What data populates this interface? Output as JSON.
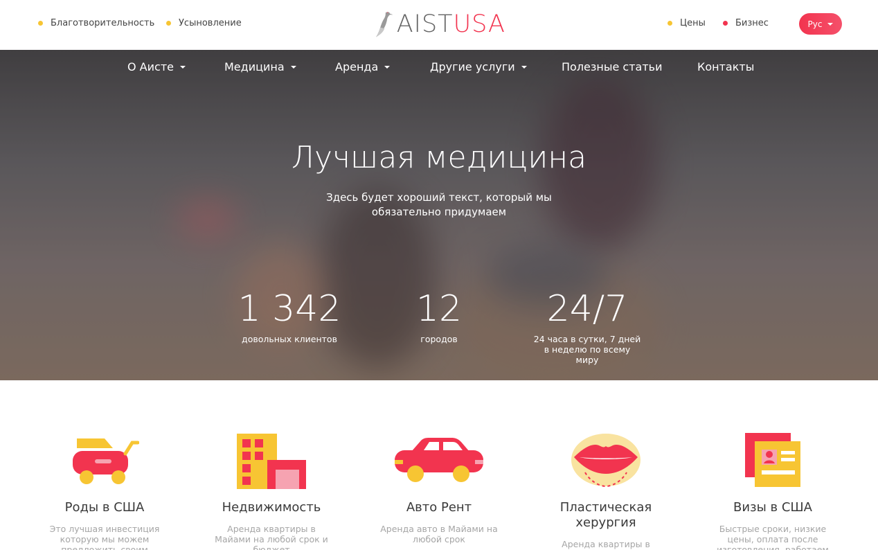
{
  "header": {
    "left_links": [
      "Благотворительность",
      "Усыновление"
    ],
    "logo": {
      "part1": "AIST",
      "part2": "USA"
    },
    "right_links": [
      "Цены",
      "Бизнес"
    ],
    "language": "Рус"
  },
  "nav": {
    "items": [
      {
        "label": "О Аисте",
        "dropdown": true
      },
      {
        "label": "Медицина",
        "dropdown": true
      },
      {
        "label": "Аренда",
        "dropdown": true
      },
      {
        "label": "Другие услуги",
        "dropdown": true
      },
      {
        "label": "Полезные статьи",
        "dropdown": false
      },
      {
        "label": "Контакты",
        "dropdown": false
      }
    ]
  },
  "hero": {
    "title": "Лучшая медицина",
    "subtitle": "Здесь будет хороший текст, который мы обязательно придумаем",
    "stats": [
      {
        "value": "1 342",
        "label": "довольных клиентов"
      },
      {
        "value": "12",
        "label": "городов"
      },
      {
        "value": "24/7",
        "label": "24 часа в сутки, 7 дней в неделю по всему миру"
      }
    ]
  },
  "services": [
    {
      "icon": "stroller-icon",
      "title": "Роды в США",
      "desc": "Это лучшая инвестиция которую мы можем предложить своим клиентам"
    },
    {
      "icon": "building-icon",
      "title": "Недвижимость",
      "desc": "Аренда квартиры в Майами на любой срок и бюджет"
    },
    {
      "icon": "car-icon",
      "title": "Авто Рент",
      "desc": "Аренда авто в Майами на любой срок"
    },
    {
      "icon": "lips-icon",
      "title": "Пластическая херургия",
      "desc": "Аренда квартиры в Майами"
    },
    {
      "icon": "visa-card-icon",
      "title": "Визы в США",
      "desc": "Быстрые сроки, низкие цены, оплата после изготовления, работаем со всеми штатами"
    }
  ],
  "colors": {
    "accent": "#f2344f",
    "yellow": "#f7c533",
    "pink_light": "#f6a3b1"
  }
}
